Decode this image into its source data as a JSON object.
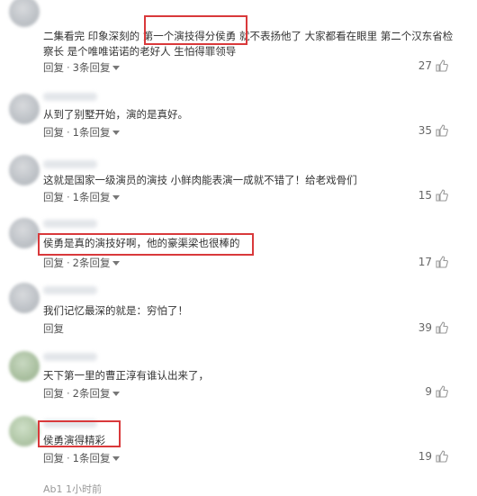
{
  "comments": [
    {
      "text": "二集看完 印象深刻的 第一个演技得分侯勇 就不表扬他了 大家都看在眼里 第二个汉东省检察长 是个唯唯诺诺的老好人 生怕得罪领导",
      "reply_label": "回复",
      "replies_label": "3条回复",
      "likes": "27"
    },
    {
      "text": "从到了别墅开始，演的是真好。",
      "reply_label": "回复",
      "replies_label": "1条回复",
      "likes": "35"
    },
    {
      "text": "这就是国家一级演员的演技 小鲜肉能表演一成就不错了！给老戏骨们",
      "reply_label": "回复",
      "replies_label": "1条回复",
      "likes": "15"
    },
    {
      "text": "侯勇是真的演技好啊，他的豪渠梁也很棒的",
      "reply_label": "回复",
      "replies_label": "2条回复",
      "likes": "17"
    },
    {
      "text": "我们记忆最深的就是：穷怕了！",
      "reply_label": "回复",
      "likes": "39"
    },
    {
      "text": "天下第一里的曹正淳有谁认出来了，",
      "reply_label": "回复",
      "replies_label": "2条回复",
      "likes": "9"
    },
    {
      "text": "侯勇演得精彩",
      "reply_label": "回复",
      "replies_label": "1条回复",
      "likes": "19"
    }
  ],
  "footer": {
    "partial_text": "Ab1 1小时前"
  },
  "colors": {
    "highlight": "#d9393b",
    "text": "#333333",
    "meta": "#555555"
  }
}
